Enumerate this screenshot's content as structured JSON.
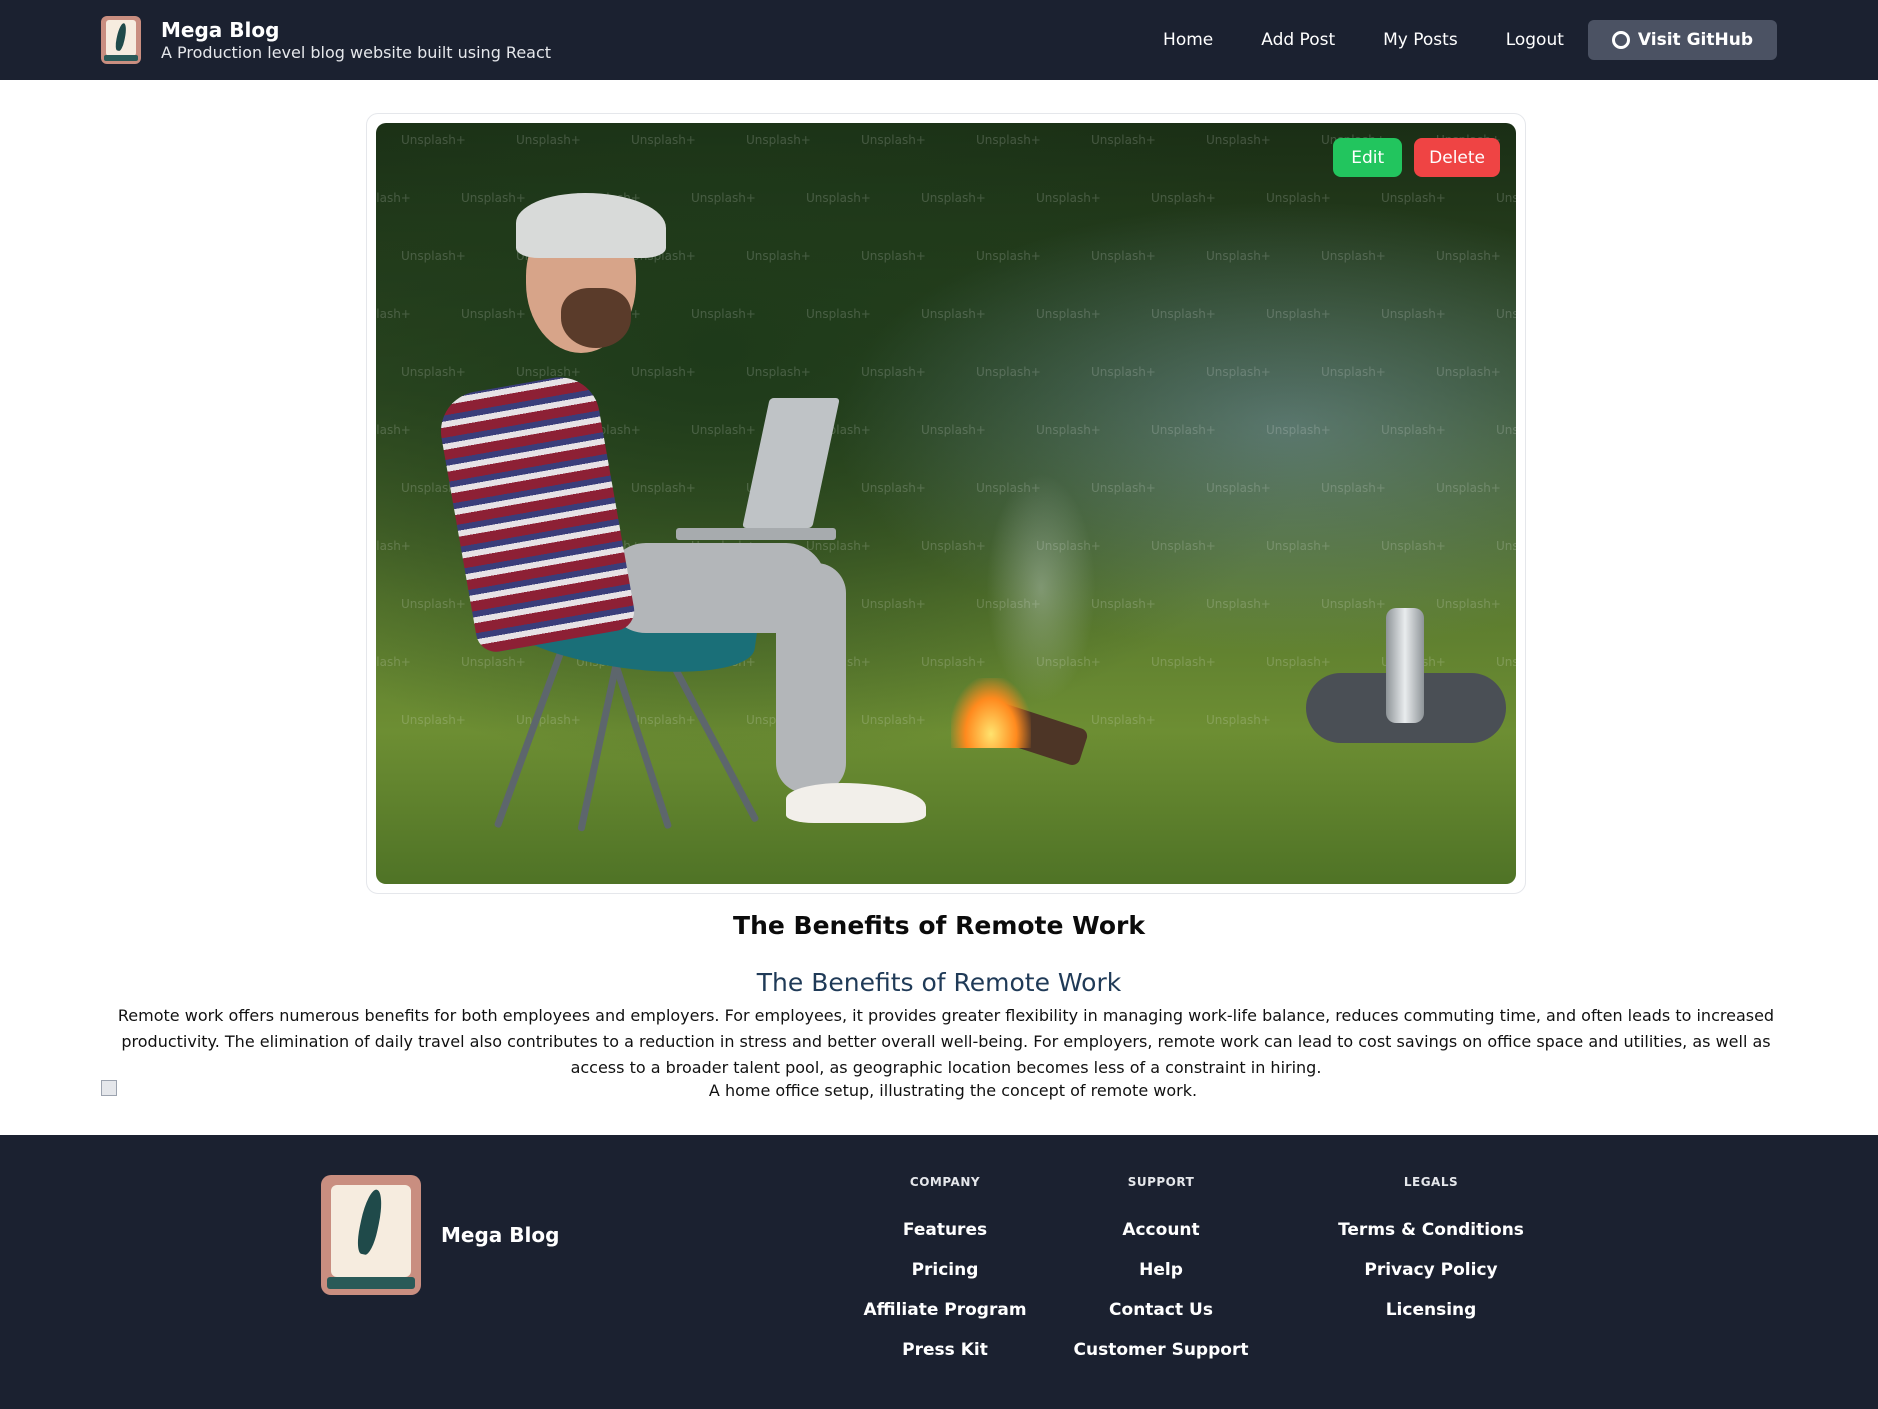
{
  "header": {
    "title": "Mega Blog",
    "subtitle": "A Production level blog website built using React",
    "nav": [
      "Home",
      "Add Post",
      "My Posts",
      "Logout"
    ],
    "github_label": "Visit GitHub"
  },
  "post": {
    "image_watermark": "Unsplash+",
    "edit_label": "Edit",
    "delete_label": "Delete",
    "title": "The Benefits of Remote Work",
    "heading": "The Benefits of Remote Work",
    "paragraph": "Remote work offers numerous benefits for both employees and employers. For employees, it provides greater flexibility in managing work-life balance, reduces commuting time, and often leads to increased productivity. The elimination of daily travel also contributes to a reduction in stress and better overall well-being. For employers, remote work can lead to cost savings on office space and utilities, as well as access to a broader talent pool, as geographic location becomes less of a constraint in hiring.",
    "caption": "A home office setup, illustrating the concept of remote work."
  },
  "footer": {
    "brand": "Mega Blog",
    "columns": [
      {
        "title": "COMPANY",
        "links": [
          "Features",
          "Pricing",
          "Affiliate Program",
          "Press Kit"
        ]
      },
      {
        "title": "SUPPORT",
        "links": [
          "Account",
          "Help",
          "Contact Us",
          "Customer Support"
        ]
      },
      {
        "title": "LEGALS",
        "links": [
          "Terms & Conditions",
          "Privacy Policy",
          "Licensing"
        ]
      }
    ]
  },
  "colors": {
    "header_bg": "#1b2130",
    "edit_button": "#22c55e",
    "delete_button": "#ef4444",
    "github_button": "#4b5263"
  }
}
